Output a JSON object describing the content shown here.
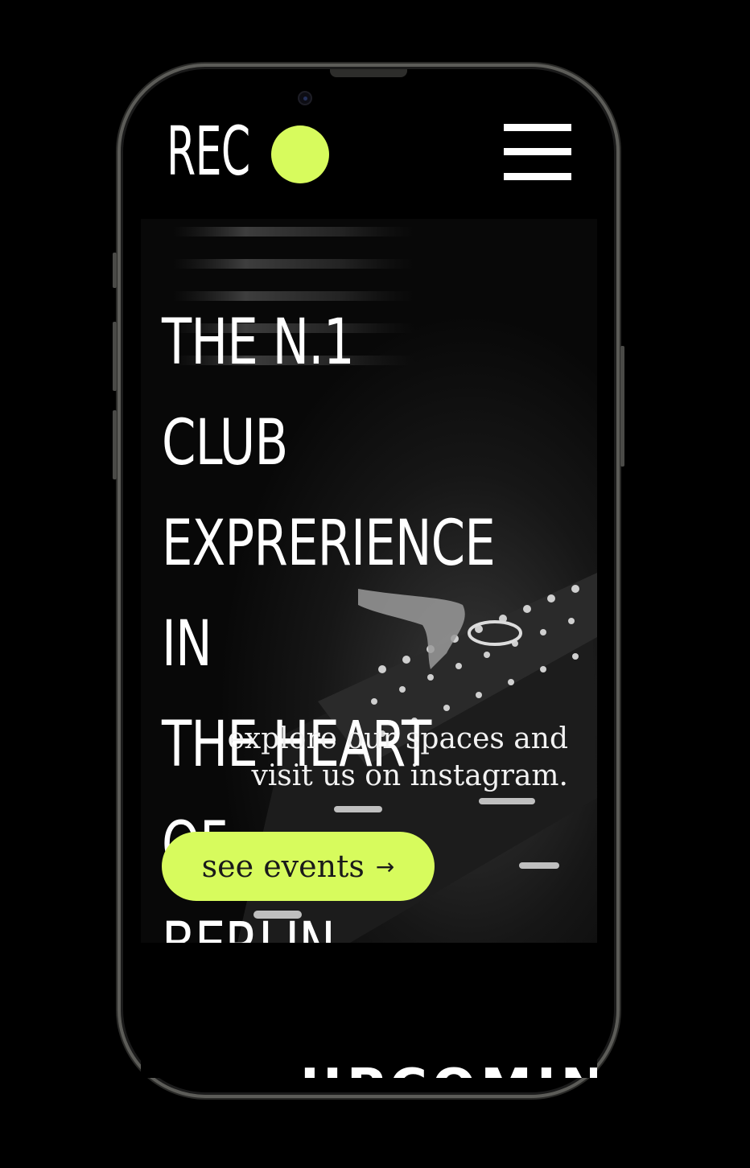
{
  "header": {
    "logo_text": "REC",
    "menu_icon": "hamburger-menu-icon"
  },
  "hero": {
    "title_lines": [
      "THE N.1 CLUB",
      "EXPRERIENCE IN",
      "THE HEART OF",
      "BERLIN"
    ],
    "subtitle_lines": [
      "explore our spaces and",
      "visit us on instagram."
    ],
    "cta_label": "see events",
    "cta_icon": "arrow-right-icon",
    "background": "dj-mixer-photo"
  },
  "next_section": {
    "title": "UPCOMING"
  },
  "colors": {
    "accent": "#d7fb5d",
    "background": "#000000",
    "text": "#ffffff"
  }
}
